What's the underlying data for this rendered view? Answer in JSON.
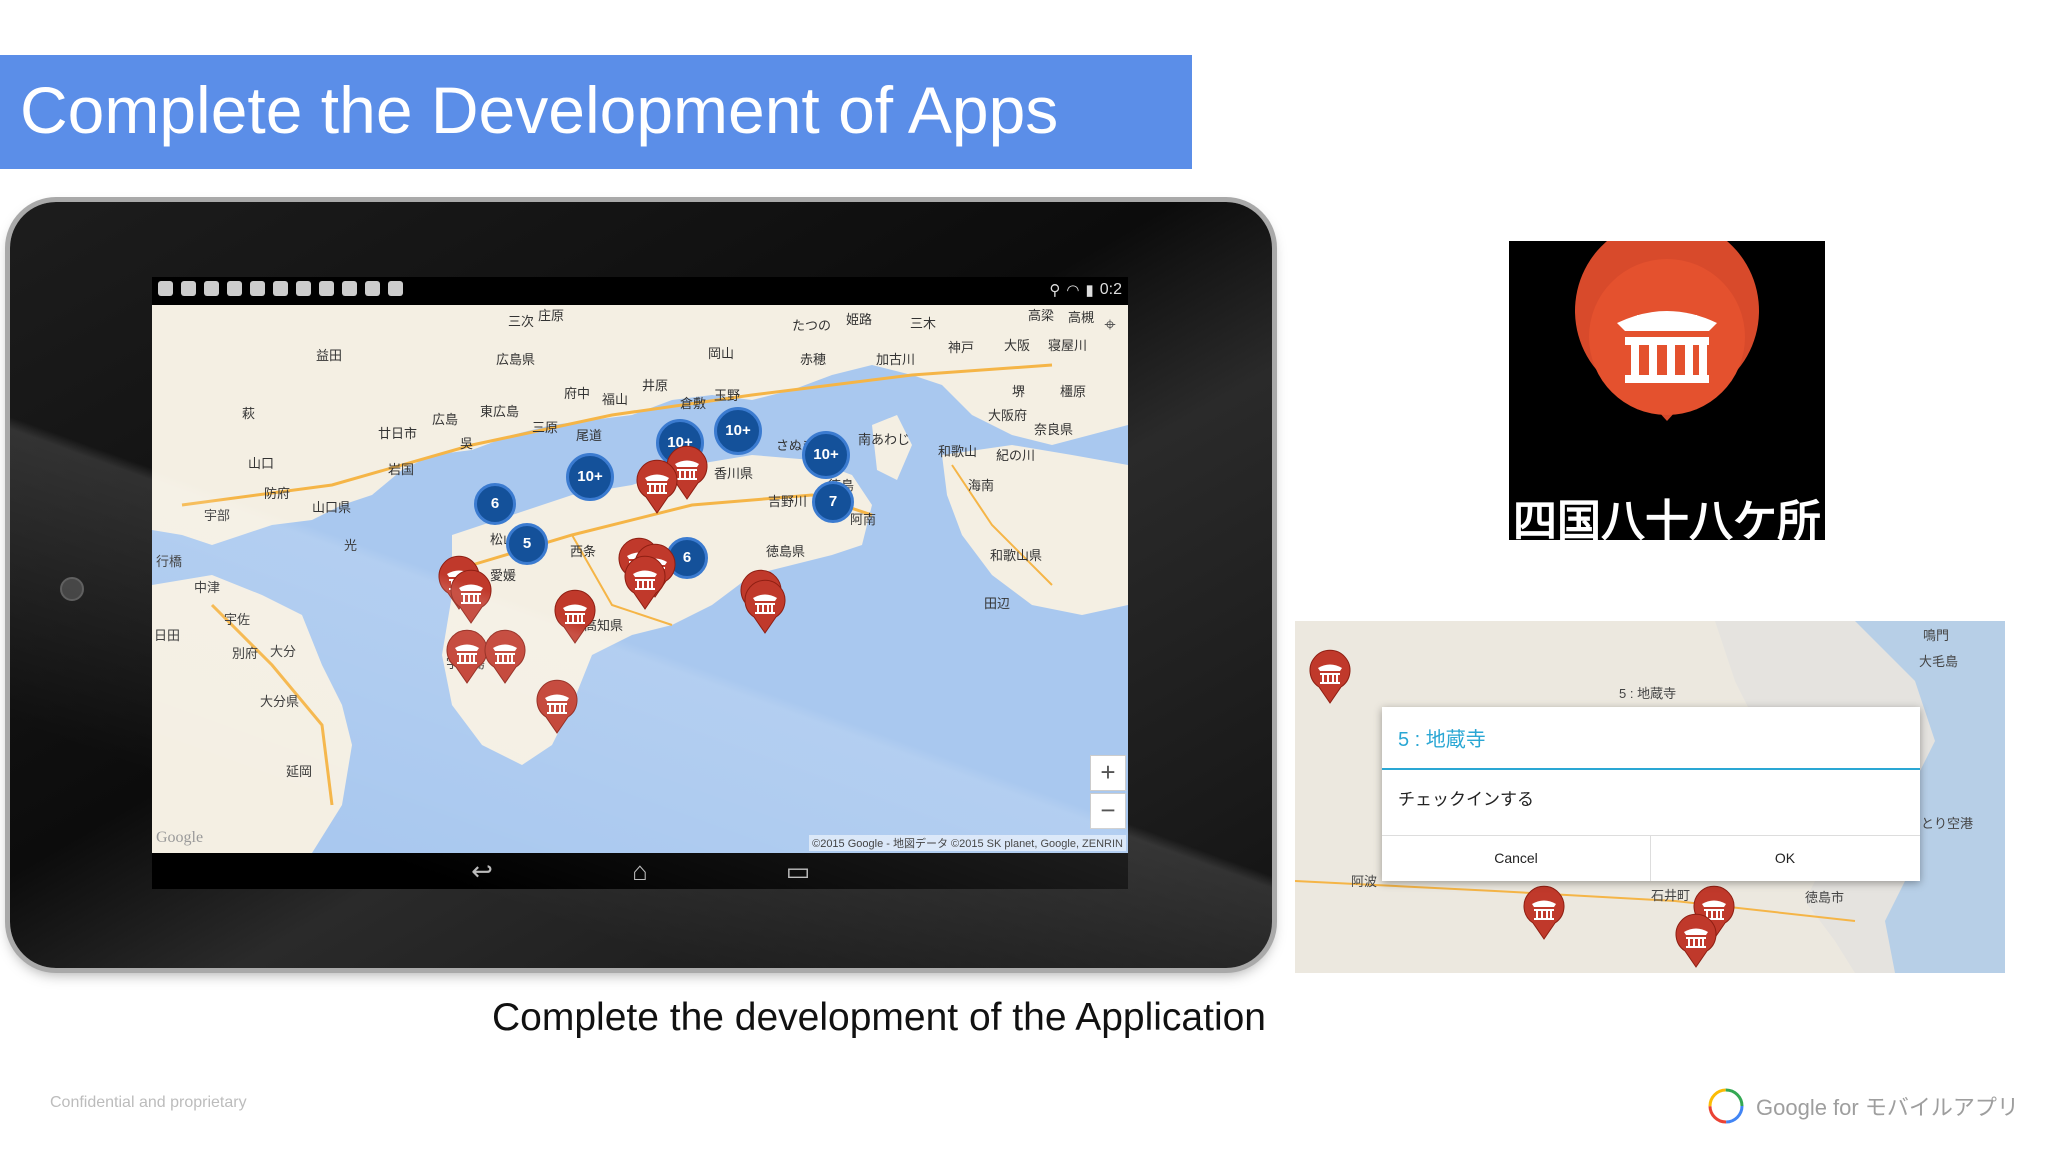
{
  "slide": {
    "title": "Complete the Development of Apps",
    "caption": "Complete the development of the Application",
    "footer_left": "Confidential and proprietary",
    "footer_right": "Google for モバイルアプリ"
  },
  "tablet": {
    "status_time": "0:2",
    "map": {
      "copyright": "©2015 Google - 地図データ ©2015 SK planet, Google, ZENRIN",
      "google_logo": "Google",
      "zoom_in": "+",
      "zoom_out": "−",
      "places": [
        "三次",
        "庄原",
        "高梁",
        "姫路",
        "三木",
        "高槻",
        "益田",
        "広島県",
        "岡山",
        "たつの",
        "赤穂",
        "加古川",
        "神戸",
        "大阪",
        "寝屋川",
        "府中",
        "井原",
        "福山",
        "倉敷",
        "玉野",
        "堺",
        "橿原",
        "萩",
        "廿日市",
        "広島",
        "東広島",
        "三原",
        "尾道",
        "吳",
        "さぬき",
        "南あわじ",
        "大阪府",
        "奈良県",
        "山口",
        "岩国",
        "香川県",
        "和歌山",
        "紀の川",
        "防府",
        "山口県",
        "徳島",
        "海南",
        "宇部",
        "松山",
        "西条",
        "吉野川",
        "阿南",
        "光",
        "愛媛",
        "徳島県",
        "和歌山県",
        "行橋",
        "中津",
        "高知県",
        "田辺",
        "宇佐",
        "宇和島",
        "日田",
        "別府",
        "大分",
        "大分県",
        "延岡"
      ],
      "clusters": [
        "10+",
        "10+",
        "10+",
        "10+",
        "6",
        "5",
        "7",
        "6"
      ]
    },
    "nav": {
      "back": "↩",
      "home": "⌂",
      "recent": "▭"
    }
  },
  "logo": {
    "text": "四国八十八ケ所",
    "accent_color": "#d84a2b"
  },
  "checkin_screenshot": {
    "map_label_top": "5 : 地蔵寺",
    "dialog_title": "5 : 地蔵寺",
    "dialog_message": "チェックインする",
    "cancel_label": "Cancel",
    "ok_label": "OK",
    "labels": [
      "阿波",
      "石井町",
      "徳島市",
      "大毛島",
      "鳴門",
      "とり空港"
    ]
  },
  "colors": {
    "title_bar": "#5b8ee8",
    "cluster": "#14519a",
    "pin": "#c0392b",
    "dialog_accent": "#2aa7d4"
  }
}
